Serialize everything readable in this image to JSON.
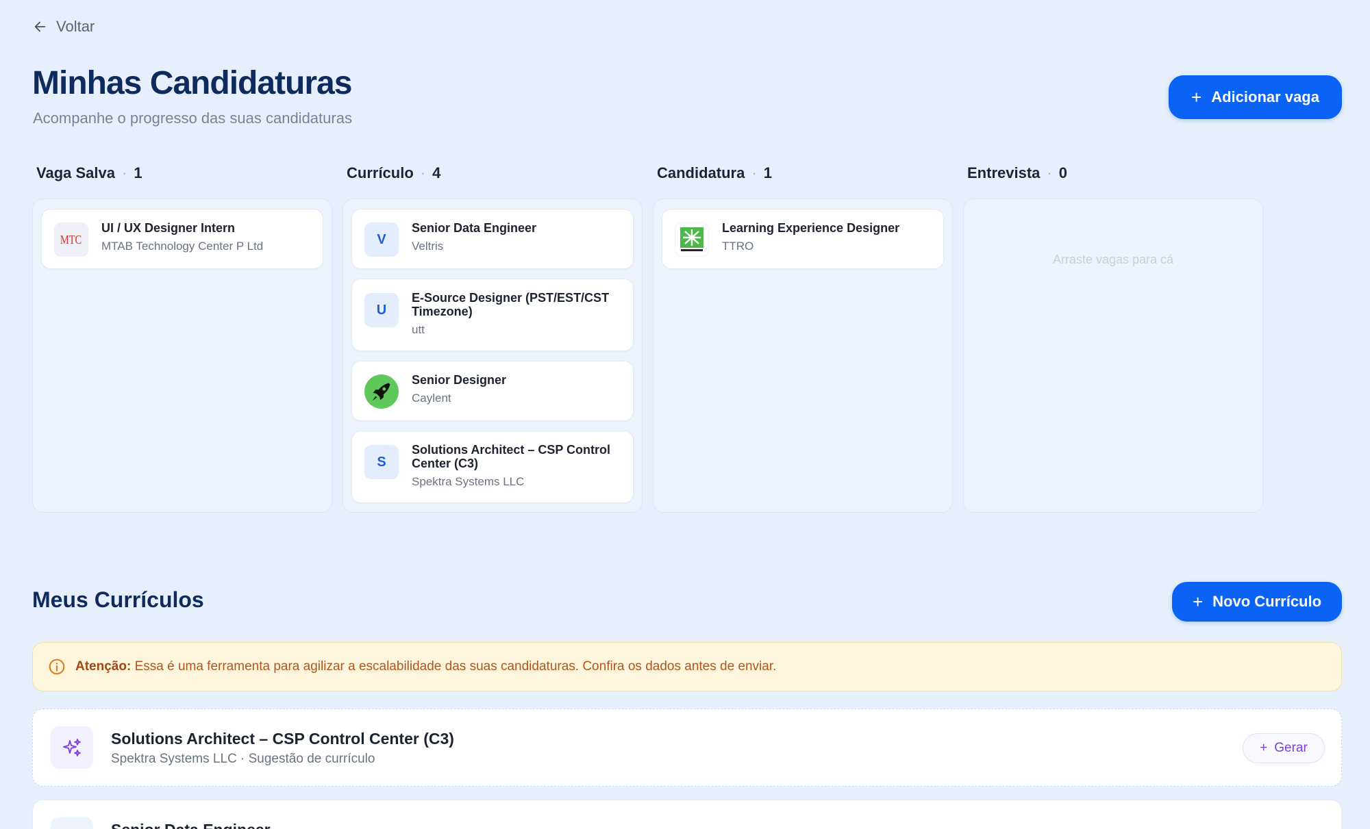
{
  "nav": {
    "back_label": "Voltar"
  },
  "header": {
    "title": "Minhas Candidaturas",
    "subtitle": "Acompanhe o progresso das suas candidaturas",
    "add_button_label": "Adicionar vaga"
  },
  "columns": [
    {
      "name": "Vaga Salva",
      "count": "1",
      "cards": [
        {
          "title": "UI / UX Designer Intern",
          "company": "MTAB Technology Center P Ltd",
          "logo_text": "MTC"
        }
      ]
    },
    {
      "name": "Currículo",
      "count": "4",
      "cards": [
        {
          "title": "Senior Data Engineer",
          "company": "Veltris",
          "logo_text": "V"
        },
        {
          "title": "E-Source Designer (PST/EST/CST Timezone)",
          "company": "utt",
          "logo_text": "U"
        },
        {
          "title": "Senior Designer",
          "company": "Caylent",
          "logo_icon": "rocket-icon"
        },
        {
          "title": "Solutions Architect – CSP Control Center (C3)",
          "company": "Spektra Systems LLC",
          "logo_text": "S"
        }
      ]
    },
    {
      "name": "Candidatura",
      "count": "1",
      "cards": [
        {
          "title": "Learning Experience Designer",
          "company": "TTRO",
          "logo_icon": "ttro-logo"
        }
      ]
    },
    {
      "name": "Entrevista",
      "count": "0",
      "empty_text": "Arraste vagas para cá",
      "cards": []
    }
  ],
  "resumes": {
    "title": "Meus Currículos",
    "new_button_label": "Novo Currículo",
    "alert": {
      "label": "Atenção:",
      "text": "Essa é uma ferramenta para agilizar a escalabilidade das suas candidaturas. Confira os dados antes de enviar."
    },
    "items": [
      {
        "title": "Solutions Architect – CSP Control Center (C3)",
        "subtitle": "Spektra Systems LLC · Sugestão de currículo",
        "action_label": "Gerar",
        "icon": "sparkles-icon"
      },
      {
        "title": "Senior Data Engineer"
      }
    ]
  },
  "colors": {
    "background": "#e6effb",
    "primary": "#0b63f6",
    "heading": "#0f2a5c",
    "warning_bg": "#fdf6dd",
    "warning_text": "#b3551a",
    "accent_purple": "#7b3fd8"
  }
}
